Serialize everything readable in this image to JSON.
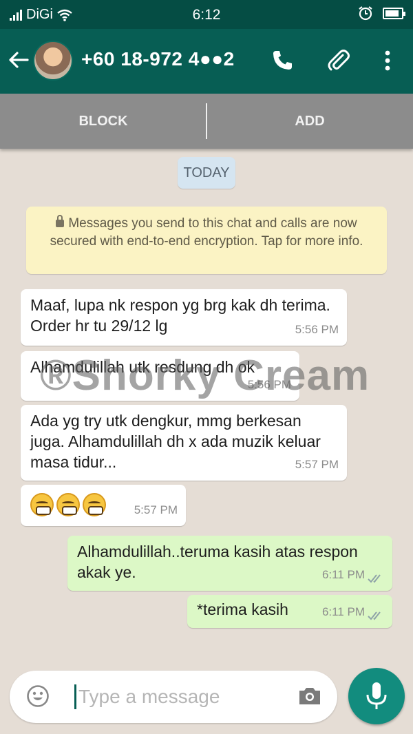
{
  "status_bar": {
    "carrier": "DiGi",
    "time": "6:12",
    "battery_level": 0.85
  },
  "header": {
    "contact": "+60 18-972 4●●2",
    "icons": [
      "back-arrow-icon",
      "avatar",
      "phone-icon",
      "paperclip-icon",
      "more-vert-icon"
    ]
  },
  "actions": {
    "block_label": "BLOCK",
    "add_label": "ADD"
  },
  "chat": {
    "date_label": "TODAY",
    "encryption_notice": "Messages you send to this chat and calls are now secured with end-to-end encryption. Tap for more info.",
    "messages": [
      {
        "dir": "in",
        "text": "Maaf, lupa nk respon yg brg kak dh terima. Order hr tu 29/12 lg",
        "time": "5:56 PM"
      },
      {
        "dir": "in",
        "text": "Alhamdulillah utk resdung dh ok",
        "time": "5:56 PM"
      },
      {
        "dir": "in",
        "text": "Ada yg try utk dengkur, mmg berkesan juga. Alhamdulillah dh x ada muzik keluar masa tidur...",
        "time": "5:57 PM"
      },
      {
        "dir": "in",
        "text": "",
        "emoji": "grimacing-face x3",
        "time": "5:57 PM"
      },
      {
        "dir": "out",
        "text": "Alhamdulillah..teruma kasih atas respon akak ye.",
        "time": "6:11 PM",
        "status": "read"
      },
      {
        "dir": "out",
        "text": "*terima kasih",
        "time": "6:11 PM",
        "status": "read"
      }
    ],
    "watermark": "®Shorky Cream"
  },
  "composer": {
    "placeholder": "Type a message",
    "icons": [
      "emoji-icon",
      "camera-icon",
      "mic-icon"
    ]
  },
  "colors": {
    "header": "#075e54",
    "status_bar": "#054d44",
    "outgoing_bubble": "#dcf8c6",
    "incoming_bubble": "#ffffff",
    "chat_bg": "#e5ddd5",
    "accent": "#128c7e"
  }
}
